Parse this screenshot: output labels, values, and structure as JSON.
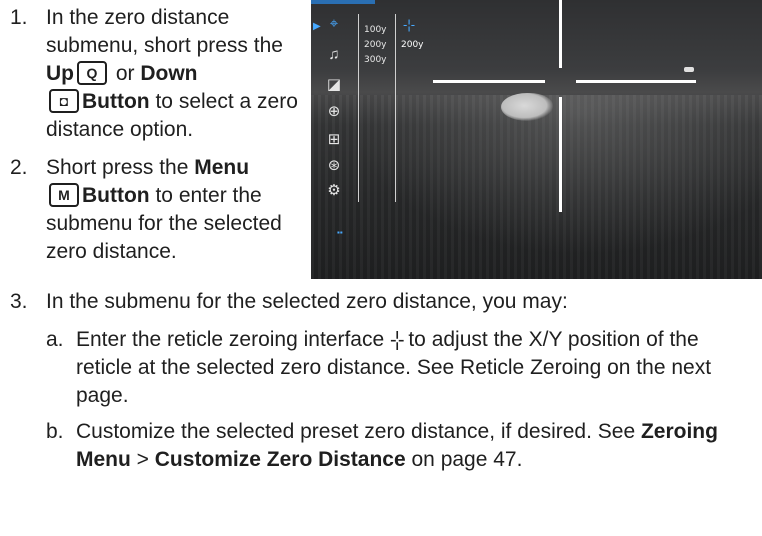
{
  "steps": [
    {
      "num": "1.",
      "t1": "In the zero distance submenu, short press the ",
      "b1": "Up",
      "key1": "Q",
      "t2": " or ",
      "b2": "Down",
      "key2": "◘",
      "b3": "Button",
      "t3": " to select a zero distance option."
    },
    {
      "num": "2.",
      "t1": "Short press the ",
      "b1": "Menu",
      "key1": "M",
      "b2": "Button",
      "t2": " to enter the submenu for the selected zero distance."
    }
  ],
  "step3": {
    "num": "3.",
    "text": "In the submenu for the selected zero distance, you may:",
    "a": {
      "num": "a.",
      "t1": "Enter the reticle zeroing interface ",
      "icon": "-¦-",
      "t2": " to adjust the X/Y position of the reticle at the selected zero distance. See Reticle Zeroing on the next page."
    },
    "b": {
      "num": "b.",
      "t1": "Customize the selected preset zero distance, if desired. See ",
      "b1": "Zeroing Menu",
      "t2": " > ",
      "b2": "Customize Zero Distance",
      "t3": " on page 47."
    }
  },
  "screen": {
    "distances": [
      "100y",
      "200y",
      "300y"
    ],
    "selected_distance": "200y",
    "menu_icons": [
      "zeroing-icon",
      "microphone-icon",
      "display-icon",
      "target-icon",
      "add-icon",
      "navigation-icon",
      "settings-icon"
    ],
    "accent_color": "#47a9ff"
  }
}
